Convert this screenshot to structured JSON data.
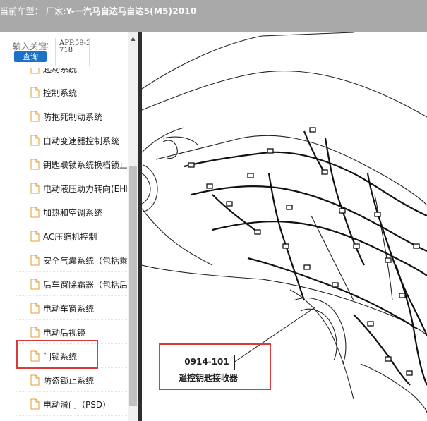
{
  "header": {
    "prefix": "当前车型：  厂家:",
    "model": "Y-一汽马自达马自达5(M5)2010"
  },
  "search": {
    "placeholder": "输入关键字",
    "button_label": "查询",
    "doc_code": "APP.59-3718"
  },
  "tree": {
    "items": [
      {
        "label": "起动系统"
      },
      {
        "label": "控制系统"
      },
      {
        "label": "防抱死制动系统"
      },
      {
        "label": "自动变速器控制系统"
      },
      {
        "label": "钥匙联锁系统换档锁止"
      },
      {
        "label": "电动液压助力转向(EHPS)"
      },
      {
        "label": "加热和空调系统"
      },
      {
        "label": "AC压缩机控制"
      },
      {
        "label": "安全气囊系统（包括乘员）"
      },
      {
        "label": "后车窗除霜器（包括后视镜）"
      },
      {
        "label": "电动车窗系统"
      },
      {
        "label": "电动后视镜"
      },
      {
        "label": "门锁系统"
      },
      {
        "label": "防盗锁止系统"
      },
      {
        "label": "电动滑门（PSD）"
      }
    ]
  },
  "diagram": {
    "part_code": "0914-101",
    "part_name": "遥控钥匙接收器"
  },
  "colors": {
    "header_bg": "#a9a9a9",
    "highlight": "#d93a3a",
    "button_bg": "#1a73c8",
    "splitter": "#2e2e2e"
  }
}
